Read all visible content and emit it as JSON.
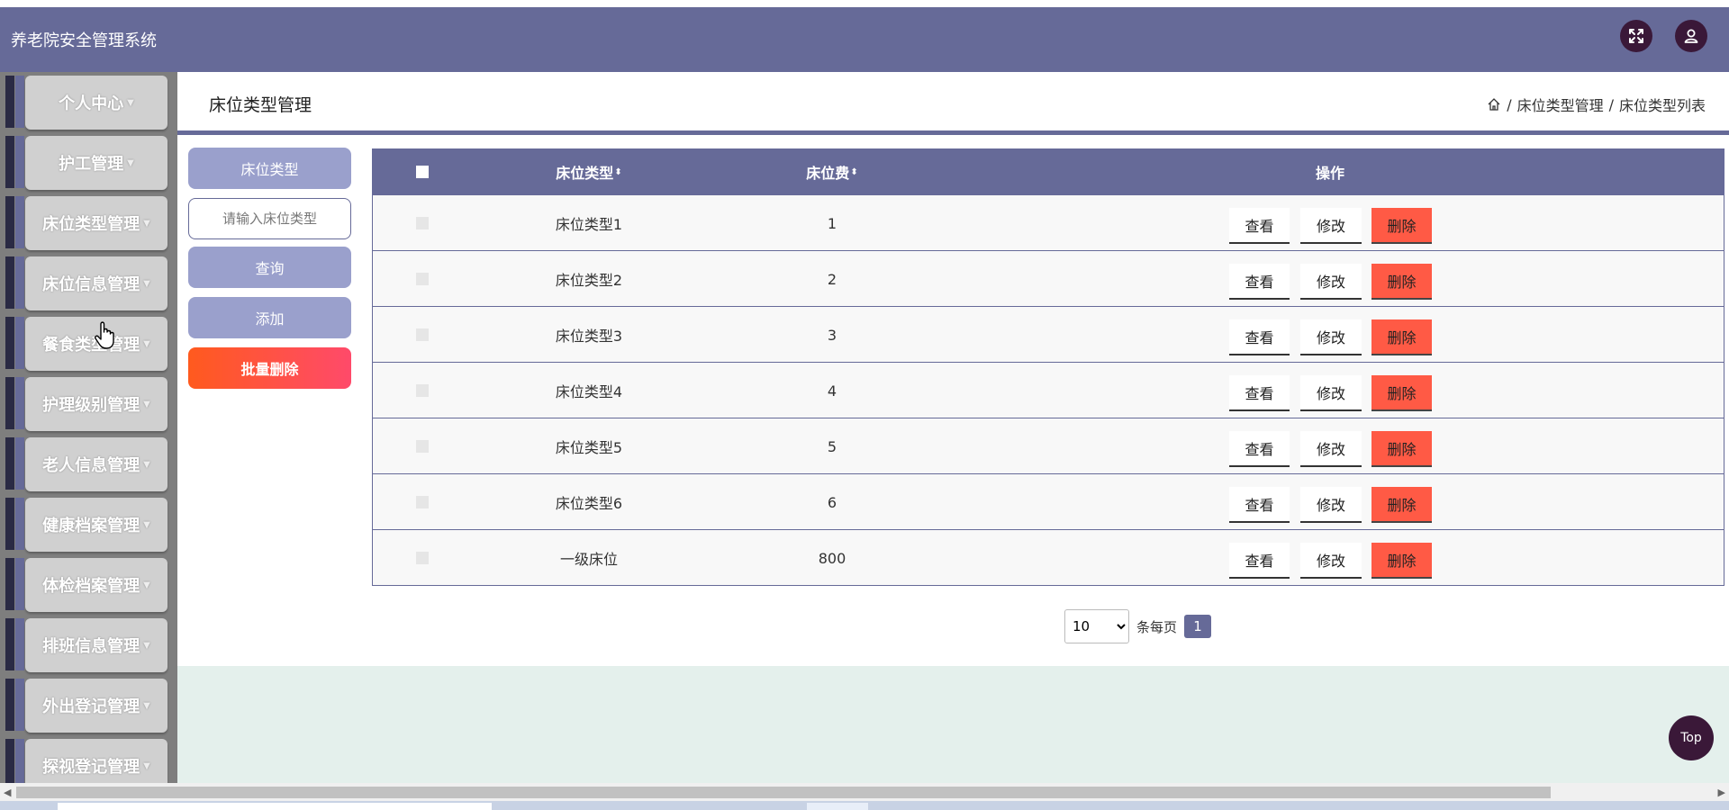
{
  "app": {
    "title": "养老院安全管理系统"
  },
  "sidebar": {
    "items": [
      {
        "label": "个人中心"
      },
      {
        "label": "护工管理"
      },
      {
        "label": "床位类型管理"
      },
      {
        "label": "床位信息管理"
      },
      {
        "label": "餐食类型管理"
      },
      {
        "label": "护理级别管理"
      },
      {
        "label": "老人信息管理"
      },
      {
        "label": "健康档案管理"
      },
      {
        "label": "体检档案管理"
      },
      {
        "label": "排班信息管理"
      },
      {
        "label": "外出登记管理"
      },
      {
        "label": "探视登记管理"
      }
    ]
  },
  "page": {
    "title": "床位类型管理",
    "breadcrumb": [
      "床位类型管理",
      "床位类型列表"
    ],
    "breadcrumb_sep": "/"
  },
  "search": {
    "field_label": "床位类型",
    "placeholder": "请输入床位类型",
    "query_label": "查询",
    "add_label": "添加",
    "batch_delete_label": "批量删除"
  },
  "table": {
    "headers": {
      "type": "床位类型",
      "fee": "床位费",
      "ops": "操作"
    },
    "rows": [
      {
        "type": "床位类型1",
        "fee": "1"
      },
      {
        "type": "床位类型2",
        "fee": "2"
      },
      {
        "type": "床位类型3",
        "fee": "3"
      },
      {
        "type": "床位类型4",
        "fee": "4"
      },
      {
        "type": "床位类型5",
        "fee": "5"
      },
      {
        "type": "床位类型6",
        "fee": "6"
      },
      {
        "type": "一级床位",
        "fee": "800"
      }
    ],
    "actions": {
      "view": "查看",
      "edit": "修改",
      "delete": "删除"
    }
  },
  "pagination": {
    "page_size": "10",
    "per_page_label": "条每页",
    "current_page": "1"
  },
  "top_button": "Top",
  "colors": {
    "header": "#666a98",
    "danger": "#ff5a45",
    "circle_button": "#3a1838",
    "footer": "#e4f0ec"
  }
}
